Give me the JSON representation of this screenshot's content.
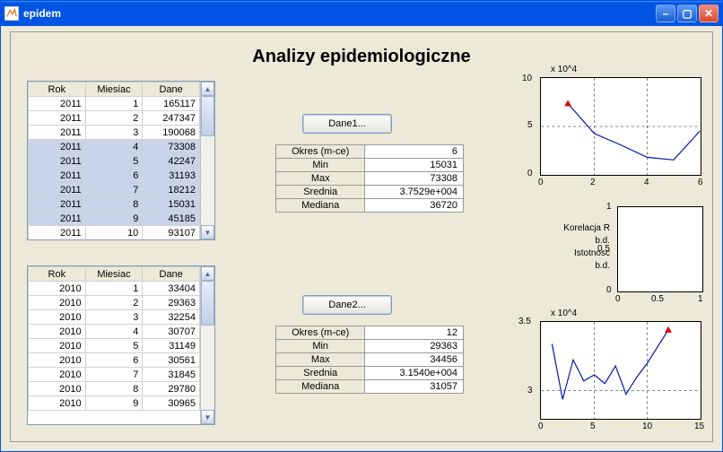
{
  "window": {
    "title": "epidem"
  },
  "page_title": "Analizy epidemiologiczne",
  "table1": {
    "headers": [
      "Rok",
      "Miesiac",
      "Dane"
    ],
    "rows": [
      {
        "rok": "2011",
        "m": "1",
        "d": "165117",
        "sel": false
      },
      {
        "rok": "2011",
        "m": "2",
        "d": "247347",
        "sel": false
      },
      {
        "rok": "2011",
        "m": "3",
        "d": "190068",
        "sel": false
      },
      {
        "rok": "2011",
        "m": "4",
        "d": "73308",
        "sel": true
      },
      {
        "rok": "2011",
        "m": "5",
        "d": "42247",
        "sel": true
      },
      {
        "rok": "2011",
        "m": "6",
        "d": "31193",
        "sel": true
      },
      {
        "rok": "2011",
        "m": "7",
        "d": "18212",
        "sel": true
      },
      {
        "rok": "2011",
        "m": "8",
        "d": "15031",
        "sel": true
      },
      {
        "rok": "2011",
        "m": "9",
        "d": "45185",
        "sel": true
      },
      {
        "rok": "2011",
        "m": "10",
        "d": "93107",
        "sel": false
      }
    ]
  },
  "table2": {
    "headers": [
      "Rok",
      "Miesiac",
      "Dane"
    ],
    "rows": [
      {
        "rok": "2010",
        "m": "1",
        "d": "33404"
      },
      {
        "rok": "2010",
        "m": "2",
        "d": "29363"
      },
      {
        "rok": "2010",
        "m": "3",
        "d": "32254"
      },
      {
        "rok": "2010",
        "m": "4",
        "d": "30707"
      },
      {
        "rok": "2010",
        "m": "5",
        "d": "31149"
      },
      {
        "rok": "2010",
        "m": "6",
        "d": "30561"
      },
      {
        "rok": "2010",
        "m": "7",
        "d": "31845"
      },
      {
        "rok": "2010",
        "m": "8",
        "d": "29780"
      },
      {
        "rok": "2010",
        "m": "9",
        "d": "30965"
      }
    ]
  },
  "buttons": {
    "dane1": "Dane1...",
    "dane2": "Dane2..."
  },
  "stats1": {
    "okres_lbl": "Okres (m-ce)",
    "okres": "6",
    "min_lbl": "Min",
    "min": "15031",
    "max_lbl": "Max",
    "max": "73308",
    "mean_lbl": "Srednia",
    "mean": "3.7529e+004",
    "med_lbl": "Mediana",
    "med": "36720"
  },
  "stats2": {
    "okres_lbl": "Okres (m-ce)",
    "okres": "12",
    "min_lbl": "Min",
    "min": "29363",
    "max_lbl": "Max",
    "max": "34456",
    "mean_lbl": "Srednia",
    "mean": "3.1540e+004",
    "med_lbl": "Mediana",
    "med": "31057"
  },
  "correlation": {
    "r_lbl": "Korelacja R",
    "r_val": "b.d.",
    "sig_lbl": "Istotnosc",
    "sig_val": "b.d."
  },
  "chart_data": [
    {
      "type": "line",
      "title": "",
      "exponent_label": "x 10^4",
      "x": [
        1,
        2,
        3,
        4,
        5,
        6
      ],
      "y": [
        73308,
        42247,
        31193,
        18212,
        15031,
        45185
      ],
      "marker_index": 0,
      "xlim": [
        0,
        6
      ],
      "ylim": [
        0,
        100000
      ],
      "xticks": [
        0,
        2,
        4,
        6
      ],
      "yticks": [
        0,
        50000,
        100000
      ],
      "ytick_labels": [
        "0",
        "5",
        "10"
      ]
    },
    {
      "type": "empty",
      "xlim": [
        0,
        1
      ],
      "ylim": [
        0,
        1
      ],
      "xticks": [
        0,
        0.5,
        1
      ],
      "yticks": [
        0,
        0.5,
        1
      ]
    },
    {
      "type": "line",
      "exponent_label": "x 10^4",
      "x": [
        1,
        2,
        3,
        4,
        5,
        6,
        7,
        8,
        9,
        10,
        11,
        12
      ],
      "y": [
        33404,
        29363,
        32254,
        30707,
        31149,
        30561,
        31845,
        29780,
        30965,
        32000,
        33200,
        34456
      ],
      "marker_index": 11,
      "xlim": [
        0,
        15
      ],
      "ylim": [
        28000,
        35000
      ],
      "xticks": [
        0,
        5,
        10,
        15
      ],
      "yticks": [
        30000,
        35000
      ],
      "ytick_labels": [
        "3",
        "3.5"
      ]
    }
  ]
}
